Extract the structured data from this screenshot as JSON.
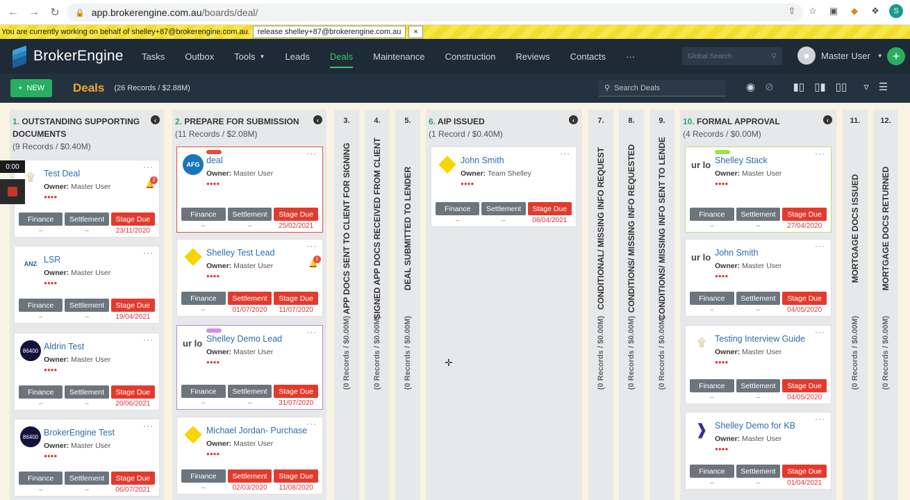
{
  "browser": {
    "url_host": "app.brokerengine.com.au",
    "url_path": "/boards/deal/",
    "profile_initial": "S"
  },
  "banner": {
    "text": "You are currently working on behalf of shelley+87@brokerengine.com.au.",
    "release_label": "release shelley+87@brokerengine.com.au",
    "close_label": "×"
  },
  "nav": {
    "brand": "BrokerEngine",
    "items": [
      "Tasks",
      "Outbox",
      "Tools",
      "Leads",
      "Deals",
      "Maintenance",
      "Construction",
      "Reviews",
      "Contacts",
      "···"
    ],
    "active": "Deals",
    "search_placeholder": "Global Search",
    "user_name": "Master User"
  },
  "toolbar": {
    "new_label": "NEW",
    "title": "Deals",
    "records": "(26 Records / $2.88M)",
    "search_placeholder": "Search Deals"
  },
  "recording": {
    "timer": "0:00"
  },
  "board": {
    "col1": {
      "num": "1.",
      "title": "OUTSTANDING SUPPORTING DOCUMENTS",
      "sub": "(9 Records / $0.40M)",
      "cards": [
        {
          "title": "Test Deal",
          "owner": "Master User",
          "bell": "2",
          "finance": "Finance",
          "settlement": "Settlement",
          "stage": "Stage Due",
          "d1": "–",
          "d2": "–",
          "d3": "23/11/2020"
        },
        {
          "title": "LSR",
          "logo": "ANZ",
          "owner": "Master User",
          "finance": "Finance",
          "settlement": "Settlement",
          "stage": "Stage Due",
          "d1": "–",
          "d2": "–",
          "d3": "19/04/2021"
        },
        {
          "title": "Aldrin Test",
          "logo": "86400",
          "owner": "Master User",
          "finance": "Finance",
          "settlement": "Settlement",
          "stage": "Stage Due",
          "d1": "–",
          "d2": "–",
          "d3": "20/06/2021"
        },
        {
          "title": "BrokerEngine Test",
          "logo": "86400",
          "owner": "Master User",
          "finance": "Finance",
          "settlement": "Settlement",
          "stage": "Stage Due",
          "d1": "–",
          "d2": "–",
          "d3": "06/07/2021"
        }
      ]
    },
    "col2": {
      "num": "2.",
      "title": "PREPARE FOR SUBMISSION",
      "sub": "(11 Records / $2.08M)",
      "cards": [
        {
          "title": "deal",
          "logo": "AFG",
          "owner": "Master User",
          "finance": "Finance",
          "settlement": "Settlement",
          "stage": "Stage Due",
          "d1": "–",
          "d2": "–",
          "d3": "25/02/2021"
        },
        {
          "title": "Shelley Test Lead",
          "owner": "Master User",
          "bell": "1",
          "finance": "Finance",
          "settlement": "Settlement",
          "stage": "Stage Due",
          "d1": "–",
          "d2": "01/07/2020",
          "d3": "11/07/2020"
        },
        {
          "title": "Shelley Demo Lead",
          "logo": "ur lo",
          "owner": "Master User",
          "finance": "Finance",
          "settlement": "Settlement",
          "stage": "Stage Due",
          "d1": "–",
          "d2": "–",
          "d3": "31/07/2020"
        },
        {
          "title": "Michael Jordan- Purchase",
          "owner": "Master User",
          "finance": "Finance",
          "settlement": "Settlement",
          "stage": "Stage Due",
          "d1": "–",
          "d2": "02/03/2020",
          "d3": "11/08/2020"
        }
      ]
    },
    "narrow": [
      {
        "num": "3.",
        "title": "APP DOCS SENT TO CLIENT FOR SIGNING",
        "sub": "(0 Records / $0.00M)"
      },
      {
        "num": "4.",
        "title": "SIGNED APP DOCS RECEIVED FROM CLIENT",
        "sub": "(0 Records / $0.00M)"
      },
      {
        "num": "5.",
        "title": "DEAL SUBMITTED TO LENDER",
        "sub": "(0 Records / $0.00M)"
      },
      {
        "num": "7.",
        "title": "CONDITIONAL/ MISSING INFO REQUEST",
        "sub": "(0 Records / $0.00M)"
      },
      {
        "num": "8.",
        "title": "CONDITIONS/ MISSING INFO REQUESTED",
        "sub": "(0 Records / $0.00M)"
      },
      {
        "num": "9.",
        "title": "CONDITIONS/ MISSING INFO SENT TO LENDE",
        "sub": "(0 Records / $0.00M)"
      },
      {
        "num": "11.",
        "title": "MORTGAGE DOCS ISSUED",
        "sub": "(0 Records / $0.00M)"
      },
      {
        "num": "12.",
        "title": "MORTGAGE DOCS RETURNED",
        "sub": "(0 Records / $0.00M)"
      }
    ],
    "col6": {
      "num": "6.",
      "title": "AIP ISSUED",
      "sub": "(1 Record / $0.40M)",
      "cards": [
        {
          "title": "John Smith",
          "owner": "Team Shelley",
          "finance": "Finance",
          "settlement": "Settlement",
          "stage": "Stage Due",
          "d1": "–",
          "d2": "–",
          "d3": "08/04/2021"
        }
      ]
    },
    "col10": {
      "num": "10.",
      "title": "FORMAL APPROVAL",
      "sub": "(4 Records / $0.00M)",
      "cards": [
        {
          "title": "Shelley Stack",
          "logo": "ur lo",
          "owner": "Master User",
          "finance": "Finance",
          "settlement": "Settlement",
          "stage": "Stage Due",
          "d1": "–",
          "d2": "–",
          "d3": "27/04/2020"
        },
        {
          "title": "John Smith",
          "logo": "ur lo",
          "owner": "Master User",
          "finance": "Finance",
          "settlement": "Settlement",
          "stage": "Stage Due",
          "d1": "–",
          "d2": "–",
          "d3": "04/05/2020"
        },
        {
          "title": "Testing Interview Guide",
          "owner": "Master User",
          "finance": "Finance",
          "settlement": "Settlement",
          "stage": "Stage Due",
          "d1": "–",
          "d2": "–",
          "d3": "04/05/2020"
        },
        {
          "title": "Shelley Demo for KB",
          "owner": "Master User",
          "finance": "Finance",
          "settlement": "Settlement",
          "stage": "Stage Due",
          "d1": "–",
          "d2": "–",
          "d3": "01/04/2021"
        }
      ]
    },
    "owner_label": "Owner:"
  },
  "colors": {
    "nav_bg": "#1e2a36",
    "active_green": "#2ecc71",
    "stage_red": "#e23b2e",
    "deals_orange": "#f5a623",
    "board_bg": "#f8f3e3"
  }
}
